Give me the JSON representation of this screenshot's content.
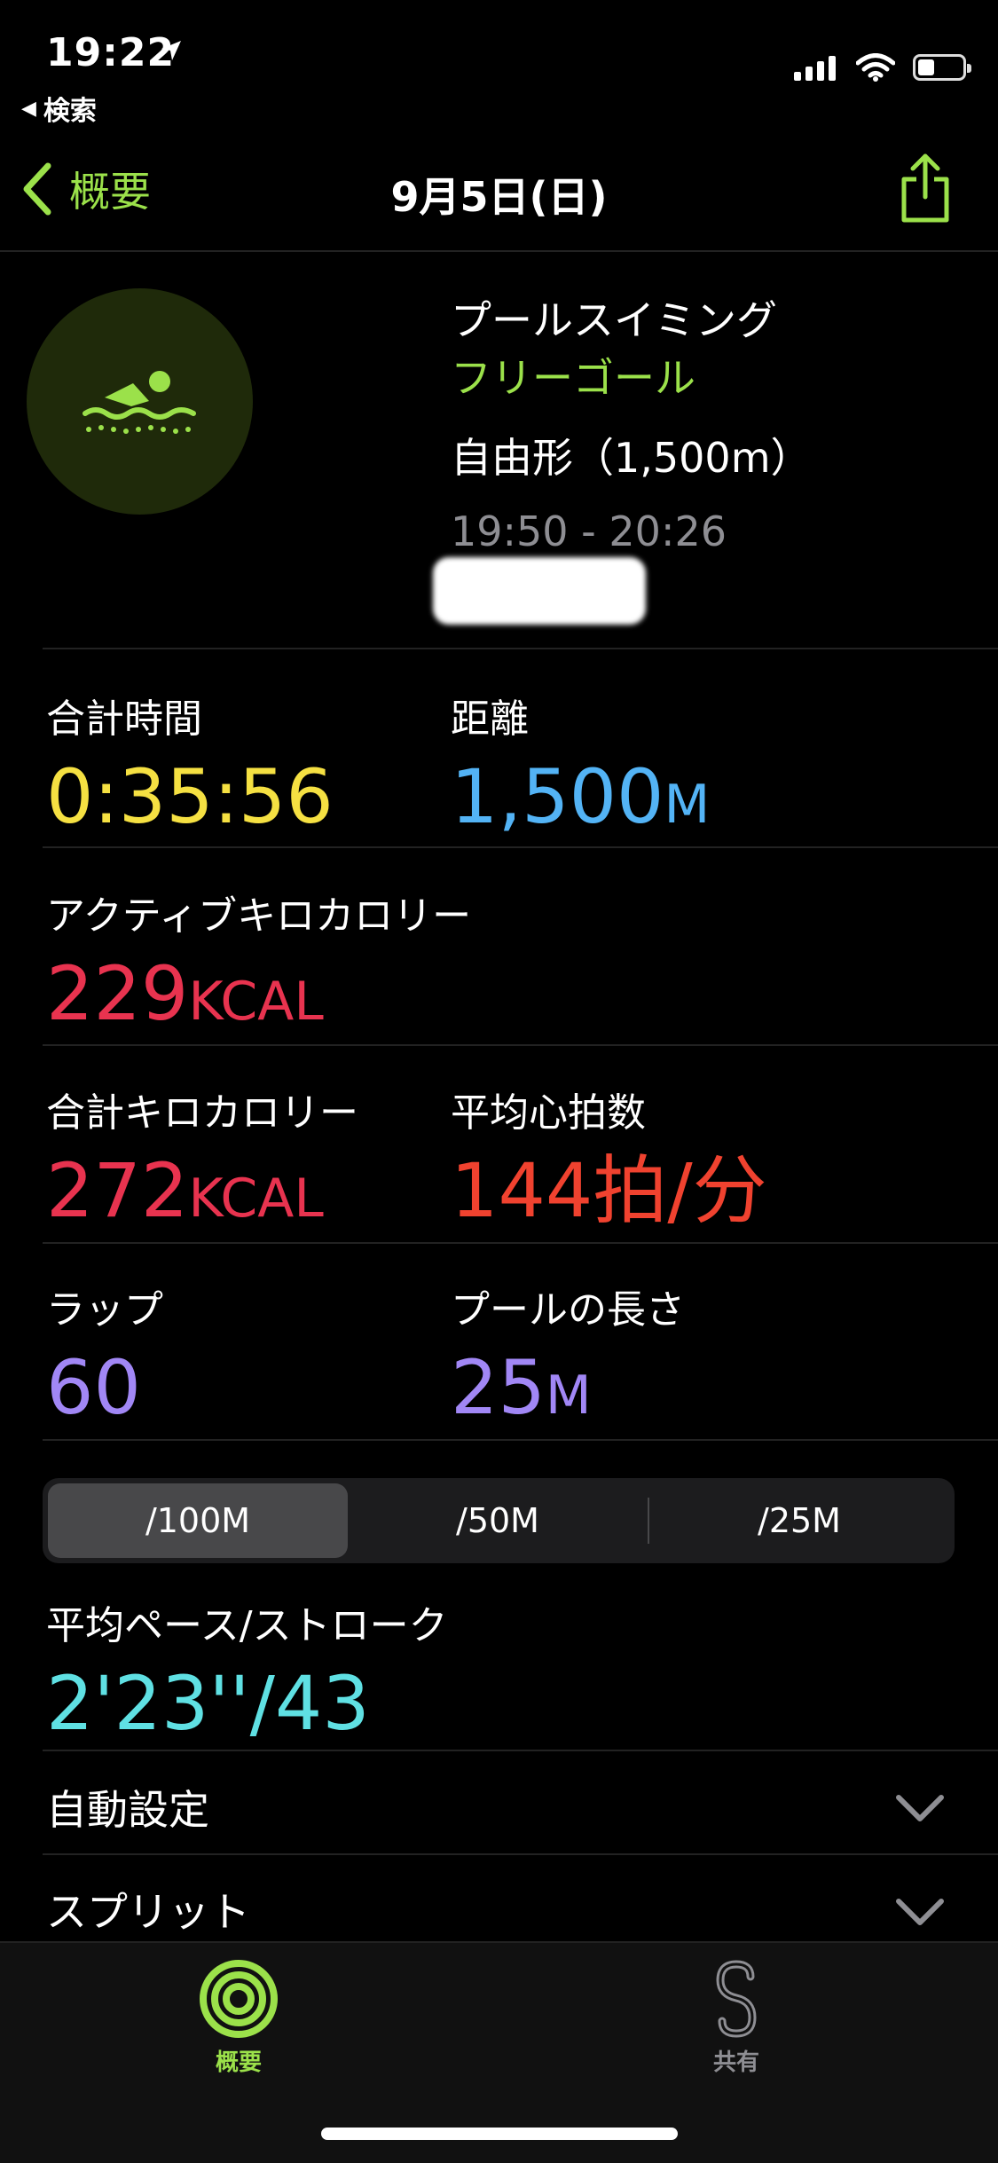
{
  "status_bar": {
    "time": "19:22",
    "back_app": "検索"
  },
  "nav": {
    "back_label": "概要",
    "title": "9月5日(日)"
  },
  "workout": {
    "icon": "swimmer-icon",
    "title": "プールスイミング",
    "goal": "フリーゴール",
    "stroke": "自由形（1,500m）",
    "time_range": "19:50 - 20:26"
  },
  "metrics": {
    "total_time": {
      "label": "合計時間",
      "value": "0:35:56",
      "color": "#f5e042"
    },
    "distance": {
      "label": "距離",
      "value": "1,500",
      "unit": "M",
      "color": "#53b3f5"
    },
    "active_kcal": {
      "label": "アクティブキロカロリー",
      "value": "229",
      "unit": "KCAL",
      "color": "#e8334f"
    },
    "total_kcal": {
      "label": "合計キロカロリー",
      "value": "272",
      "unit": "KCAL",
      "color": "#e8334f"
    },
    "avg_hr": {
      "label": "平均心拍数",
      "value": "144拍/分",
      "color": "#f0422f"
    },
    "laps": {
      "label": "ラップ",
      "value": "60",
      "color": "#a187f5"
    },
    "pool_length": {
      "label": "プールの長さ",
      "value": "25",
      "unit": "M",
      "color": "#a187f5"
    }
  },
  "segments": [
    "/100M",
    "/50M",
    "/25M"
  ],
  "selected_segment": "/100M",
  "pace": {
    "label": "平均ペース/ストローク",
    "value": "2'23''/43",
    "color": "#5fe0e3"
  },
  "rows": [
    {
      "label": "自動設定"
    },
    {
      "label": "スプリット"
    }
  ],
  "tabs": [
    {
      "label": "概要",
      "icon": "activity-rings-icon",
      "active": true
    },
    {
      "label": "共有",
      "icon": "sharing-icon",
      "active": false
    }
  ]
}
